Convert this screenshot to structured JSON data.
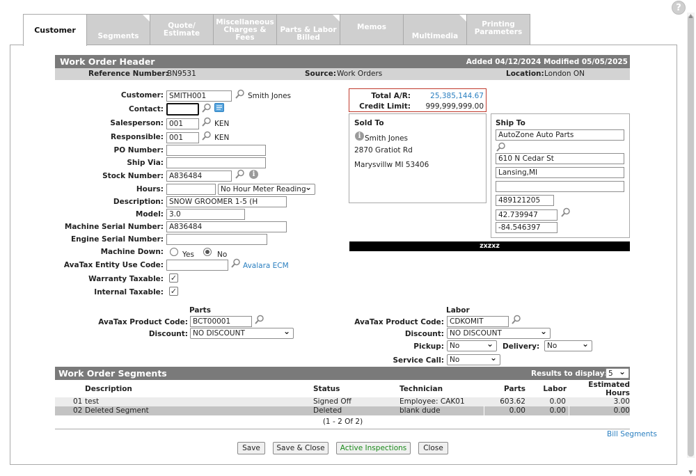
{
  "help_label": "?",
  "tabs": [
    {
      "label": "Customer",
      "active": true
    },
    {
      "label": "Segments"
    },
    {
      "label": "Quote/ Estimate"
    },
    {
      "label": "Miscellaneous Charges & Fees"
    },
    {
      "label": "Parts & Labor Billed"
    },
    {
      "label": "Memos"
    },
    {
      "label": "Multimedia"
    },
    {
      "label": "Printing Parameters"
    }
  ],
  "header": {
    "title": "Work Order Header",
    "added_modified": "Added 04/12/2024 Modified 05/05/2025"
  },
  "refbar": {
    "reference_label": "Reference Number:",
    "reference_value": "BN9531",
    "source_label": "Source:",
    "source_value": "Work Orders",
    "location_label": "Location:",
    "location_value": "London ON"
  },
  "form": {
    "customer_label": "Customer:",
    "customer_value": "SMITH001",
    "customer_name": "Smith Jones",
    "contact_label": "Contact:",
    "contact_value": "",
    "salesperson_label": "Salesperson:",
    "salesperson_value": "001",
    "salesperson_name": "KEN",
    "responsible_label": "Responsible:",
    "responsible_value": "001",
    "responsible_name": "KEN",
    "po_label": "PO Number:",
    "po_value": "",
    "shipvia_label": "Ship Via:",
    "shipvia_value": "",
    "stock_label": "Stock Number:",
    "stock_value": "A836484",
    "hours_label": "Hours:",
    "hours_value": "",
    "hours_meter": "No Hour Meter Reading",
    "description_label": "Description:",
    "description_value": "SNOW GROOMER 1-5 (H",
    "model_label": "Model:",
    "model_value": "3.0",
    "machine_serial_label": "Machine Serial Number:",
    "machine_serial_value": "A836484",
    "engine_serial_label": "Engine Serial Number:",
    "engine_serial_value": "",
    "machine_down_label": "Machine Down:",
    "yes_label": "Yes",
    "no_label": "No",
    "avatax_entity_label": "AvaTax Entity Use Code:",
    "avatax_entity_value": "",
    "avalara_link": "Avalara ECM",
    "warranty_label": "Warranty Taxable:",
    "internal_label": "Internal Taxable:",
    "check_mark": "✓"
  },
  "ar": {
    "total_label": "Total A/R:",
    "total_value": "25,385,144.67",
    "credit_label": "Credit Limit:",
    "credit_value": "999,999,999.00"
  },
  "sold_to": {
    "title": "Sold To",
    "name": "Smith Jones",
    "street": "2870 Gratiot Rd",
    "city": "Marysvillw MI 53406"
  },
  "ship_to": {
    "title": "Ship To",
    "name": "AutoZone Auto Parts",
    "street": "610 N Cedar St",
    "city": "Lansing,MI",
    "line4": "",
    "phone": "489121205",
    "lat": "42.739947",
    "lon": "-84.546397"
  },
  "banner_text": "zxzxz",
  "parts": {
    "title": "Parts",
    "product_label": "AvaTax Product Code:",
    "product_value": "BCT00001",
    "discount_label": "Discount:",
    "discount_value": "NO DISCOUNT"
  },
  "labor": {
    "title": "Labor",
    "product_label": "AvaTax Product Code:",
    "product_value": "CDKOMIT",
    "discount_label": "Discount:",
    "discount_value": "NO DISCOUNT",
    "pickup_label": "Pickup:",
    "pickup_value": "No",
    "delivery_label": "Delivery:",
    "delivery_value": "No",
    "service_label": "Service Call:",
    "service_value": "No"
  },
  "segments": {
    "title": "Work Order Segments",
    "results_label": "Results to display:",
    "results_value": "5",
    "columns": {
      "description": "Description",
      "status": "Status",
      "technician": "Technician",
      "parts": "Parts",
      "labor": "Labor",
      "hours": "Estimated Hours"
    },
    "rows": [
      {
        "num": "01",
        "description": "test",
        "status": "Signed Off",
        "technician": "Employee: CAK01",
        "parts": "603.62",
        "labor": "0.00",
        "hours": "3.00"
      },
      {
        "num": "02",
        "description": "Deleted Segment",
        "status": "Deleted",
        "technician": "blank dude",
        "parts": "0.00",
        "labor": "0.00",
        "hours": "0.00"
      }
    ],
    "pager": "(1 - 2 Of 2)",
    "bill_link": "Bill Segments"
  },
  "buttons": {
    "save": "Save",
    "save_close": "Save & Close",
    "inspections": "Active Inspections",
    "close": "Close"
  },
  "colors": {
    "header_bg": "#7a7a7a",
    "refbar_bg": "#d3d3d3",
    "link": "#2a7fc0",
    "ar_border": "#c0392b",
    "green_button": "#1b8a1b"
  }
}
